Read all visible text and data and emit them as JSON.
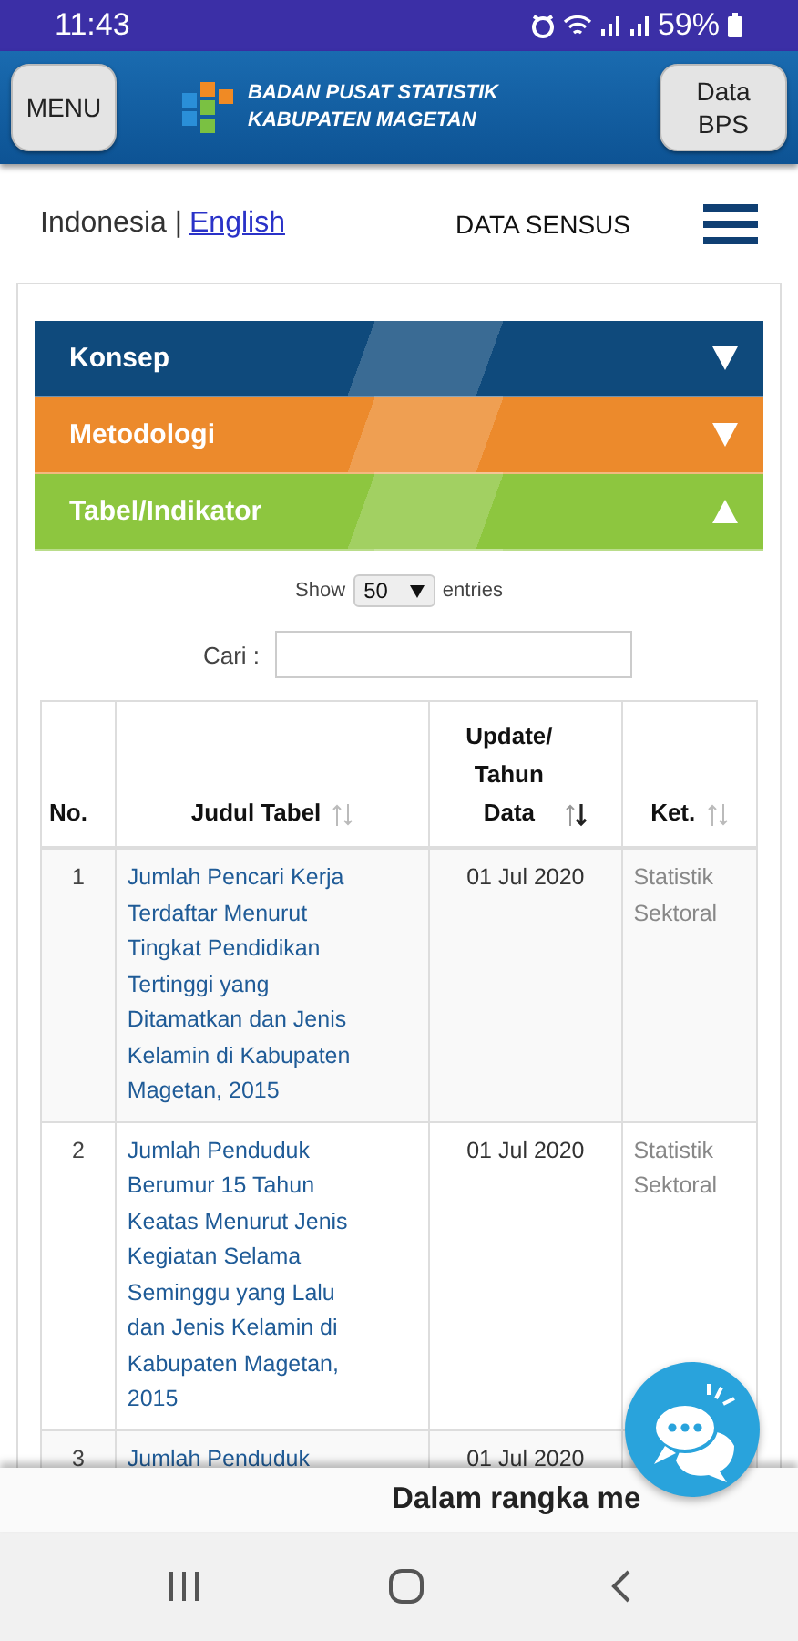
{
  "status_bar": {
    "time": "11:43",
    "battery": "59%"
  },
  "header": {
    "menu_button": "MENU",
    "logo_lines": [
      "BADAN PUSAT STATISTIK",
      "KABUPATEN MAGETAN"
    ],
    "data_button": "Data BPS"
  },
  "nav": {
    "language": "Indonesia |",
    "language_link": "English",
    "title": "DATA SENSUS"
  },
  "accordion": [
    {
      "label": "Konsep",
      "color": "#0f4a7c",
      "expanded": false
    },
    {
      "label": "Metodologi",
      "color": "#ec8a2c",
      "expanded": false
    },
    {
      "label": "Tabel/Indikator",
      "color": "#8dc63f",
      "expanded": true
    }
  ],
  "table_controls": {
    "show_label": "Show",
    "page_size": "50",
    "entries_label": "entries",
    "search_label": "Cari :"
  },
  "table": {
    "columns": [
      {
        "label": "No.",
        "sortable": false
      },
      {
        "label": "Judul Tabel",
        "sortable": true,
        "sorted": false
      },
      {
        "label": "Update/ Tahun Data",
        "sortable": true,
        "sorted": true
      },
      {
        "label": "Ket.",
        "sortable": true,
        "sorted": false
      }
    ],
    "rows": [
      {
        "no": "1",
        "title": "Jumlah Pencari Kerja Terdaftar Menurut Tingkat Pendidikan Tertinggi yang Ditamatkan dan Jenis Kelamin di Kabupaten Magetan, 2015",
        "date": "01 Jul 2020",
        "note": "Statistik Sektoral"
      },
      {
        "no": "2",
        "title": "Jumlah Penduduk Berumur 15 Tahun Keatas Menurut Jenis Kegiatan Selama Seminggu yang Lalu dan Jenis Kelamin di Kabupaten Magetan, 2015",
        "date": "01 Jul 2020",
        "note": "Statistik Sektoral"
      },
      {
        "no": "3",
        "title": "Jumlah Penduduk",
        "date": "01 Jul 2020"
      }
    ]
  },
  "ticker": {
    "text": "Dalam rangka me"
  }
}
